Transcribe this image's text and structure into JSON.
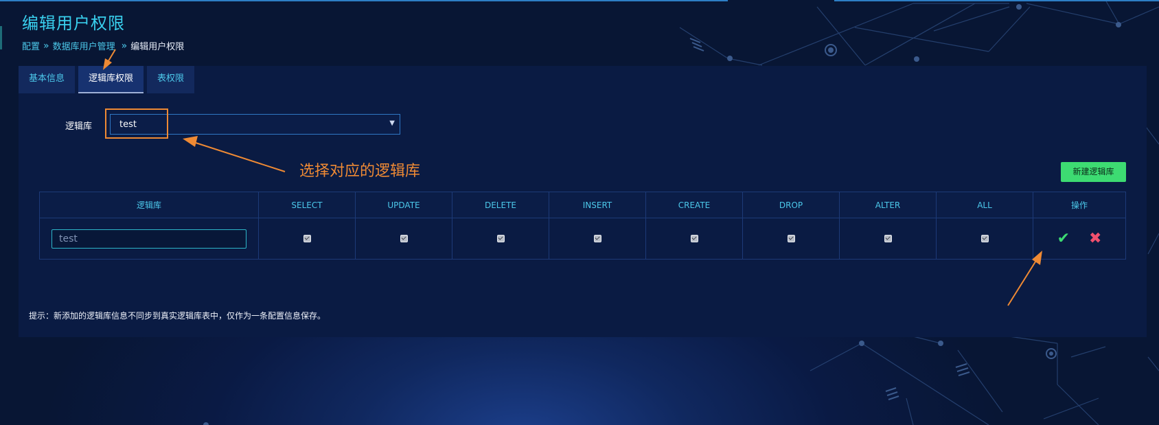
{
  "page": {
    "title": "编辑用户权限"
  },
  "breadcrumb": [
    {
      "label": "配置"
    },
    {
      "label": "数据库用户管理"
    },
    {
      "label": "编辑用户权限"
    }
  ],
  "tabs": [
    {
      "label": "基本信息",
      "active": false
    },
    {
      "label": "逻辑库权限",
      "active": true
    },
    {
      "label": "表权限",
      "active": false
    }
  ],
  "db_select": {
    "label": "逻辑库",
    "value": "test"
  },
  "annotation": {
    "text": "选择对应的逻辑库",
    "color": "#ef8a34"
  },
  "new_button": {
    "label": "新建逻辑库",
    "color": "#3ddb72"
  },
  "table": {
    "headers": [
      "逻辑库",
      "SELECT",
      "UPDATE",
      "DELETE",
      "INSERT",
      "CREATE",
      "DROP",
      "ALTER",
      "ALL",
      "操作"
    ],
    "rows": [
      {
        "name": "test",
        "perms": [
          true,
          true,
          true,
          true,
          true,
          true,
          true,
          true
        ]
      }
    ],
    "actions": {
      "confirm_icon": "check-icon",
      "delete_icon": "close-icon"
    }
  },
  "tip": "提示：新添加的逻辑库信息不同步到真实逻辑库表中，仅作为一条配置信息保存。",
  "colors": {
    "accent": "#39d0ee",
    "link": "#4cc8ea",
    "panel": "#0a1b43",
    "danger": "#f0506e"
  }
}
